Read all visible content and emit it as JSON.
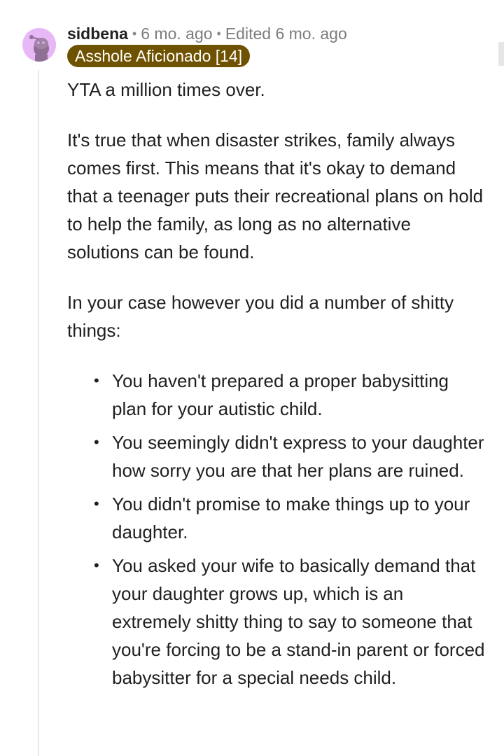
{
  "comment": {
    "author": "sidbena",
    "separator": "•",
    "age": "6 mo. ago",
    "edited": "Edited 6 mo. ago",
    "flair": "Asshole Aficionado [14]",
    "avatar_color": "#e8b7f7",
    "flair_color": "#6f5200",
    "paragraphs": [
      "YTA a million times over.",
      "It's true that when disaster strikes, family always comes first. This means that it's okay to demand that a teenager puts their recreational plans on hold to help the family, as long as no alternative solutions can be found.",
      "In your case however you did a number of shitty things:"
    ],
    "bullets": [
      "You haven't prepared a proper babysitting plan for your autistic child.",
      "You seemingly didn't express to your daughter how sorry you are that her plans are ruined.",
      "You didn't promise to make things up to your daughter.",
      "You asked your wife to basically demand that your daughter grows up, which is an extremely shitty thing to say to someone that you're forcing to be a stand-in parent or forced babysitter for a special needs child."
    ],
    "bullet_glyph": "•"
  }
}
